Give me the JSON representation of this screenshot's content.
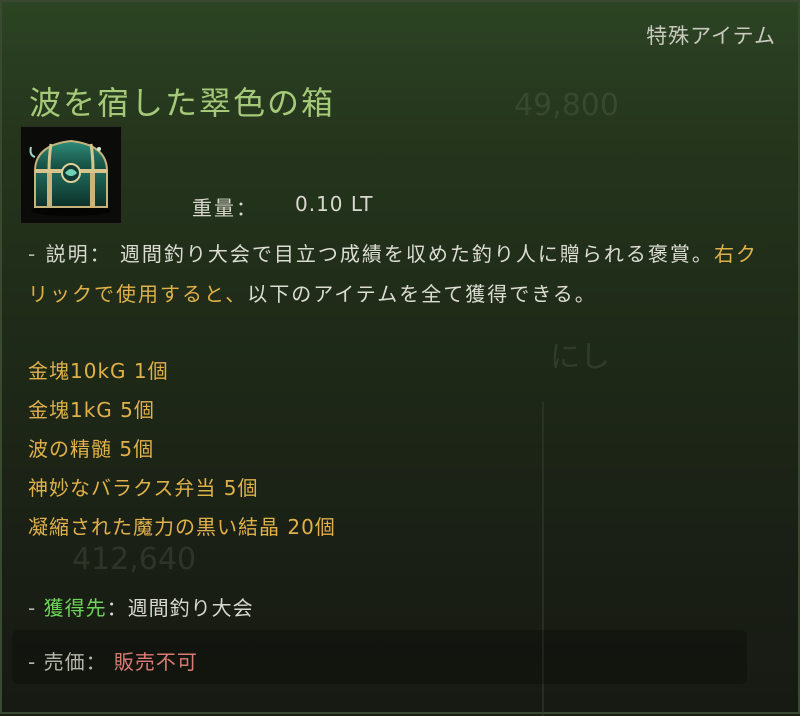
{
  "tooltip": {
    "category": "特殊アイテム",
    "title": "波を宿した翠色の箱",
    "icon": "emerald-treasure-chest-icon",
    "weight": {
      "label": "重量：",
      "value": "0.10 LT"
    },
    "description": {
      "prefix": "- ",
      "label": "説明：",
      "text_white": " 週間釣り大会で目立つ成績を収めた釣り人に贈られる褒賞。",
      "text_gold": "右クリックで使用すると、",
      "text_white2": "以下のアイテムを全て獲得できる。"
    },
    "contents": [
      "金塊10kG 1個",
      "金塊1kG 5個",
      "波の精髄 5個",
      "神妙なバラクス弁当 5個",
      "凝縮された魔力の黒い結晶 20個"
    ],
    "source": {
      "prefix": "- ",
      "label": "獲得先",
      "value": "：週間釣り大会"
    },
    "price": {
      "prefix": "- ",
      "label": "売価：",
      "value": " 販売不可"
    },
    "colors": {
      "title": "#a5c978",
      "gold": "#e0b14a",
      "source_label": "#6fd45a",
      "not_for_sale": "#d97a74"
    }
  },
  "background_ghost": [
    "49,800",
    "412,640",
    "にし"
  ]
}
